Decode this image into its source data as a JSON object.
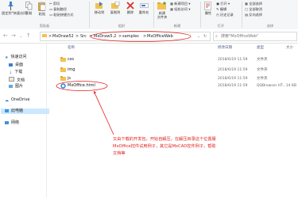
{
  "ribbon": {
    "pin_label": "固定到\"快速访问\"",
    "copy_label": "复制",
    "paste_label": "粘贴",
    "cut_label": "剪切",
    "copy_path_label": "复制路径",
    "paste_shortcut_label": "粘贴快捷方式",
    "move_to_label": "移动到",
    "copy_to_label": "复制到",
    "delete_label": "删除",
    "rename_label": "重命名",
    "new_folder_label": "新建\n文件夹",
    "new_item_label": "新建项目 ▾",
    "easy_access_label": "轻松访问 ▾",
    "properties_label": "属性",
    "open_label": "打开 ▾",
    "edit_label": "编辑",
    "history_label": "历史记录",
    "select_all_label": "全部选择",
    "select_none_label": "全部取消",
    "invert_selection_label": "反向选择",
    "group_clipboard": "剪贴板",
    "group_organize": "组织",
    "group_new": "新建",
    "group_open": "打开",
    "group_select": "选择"
  },
  "address": {
    "crumbs": [
      "MxDraw52",
      "Src",
      "MxDraw5.2",
      "samples",
      "MxOfficeWeb"
    ],
    "separator": ">",
    "search_placeholder": "搜索\"MxOfficeWeb\""
  },
  "sidebar": {
    "items": [
      {
        "label": "快速访问",
        "icon": "star-icon"
      },
      {
        "label": "桌面",
        "icon": "desktop-icon"
      },
      {
        "label": "下载",
        "icon": "download-icon"
      },
      {
        "label": "文档",
        "icon": "document-icon"
      },
      {
        "label": "图片",
        "icon": "picture-icon"
      },
      {
        "label": "OneDrive",
        "icon": "cloud-icon"
      },
      {
        "label": "此电脑",
        "icon": "computer-icon"
      },
      {
        "label": "网络",
        "icon": "network-icon"
      }
    ]
  },
  "columns": {
    "name": "名称",
    "date": "修改日期",
    "type": "类型",
    "size": "大小"
  },
  "files": [
    {
      "name": "css",
      "date": "2018/6/19 11:59",
      "type": "文件夹",
      "size": "",
      "icon": "folder-icon"
    },
    {
      "name": "img",
      "date": "2018/6/19 11:59",
      "type": "文件夹",
      "size": "",
      "icon": "folder-icon"
    },
    {
      "name": "js",
      "date": "2018/6/19 11:59",
      "type": "文件夹",
      "size": "",
      "icon": "folder-icon"
    },
    {
      "name": "MxOffice.html",
      "date": "2018/6/19 11:59",
      "type": "QQBrowser HT...",
      "size": "14 KB",
      "icon": "html-file-icon"
    }
  ],
  "annotation": "又由下载的开发包，开始自解压，在解压目录这个位置服MxOffice控件试用例子，其它是MxCAD控件例子，帮助文档等",
  "colors": {
    "annotation": "#e0201b",
    "folder": "#f3c24f",
    "selected_nav": "#cce8ff"
  }
}
